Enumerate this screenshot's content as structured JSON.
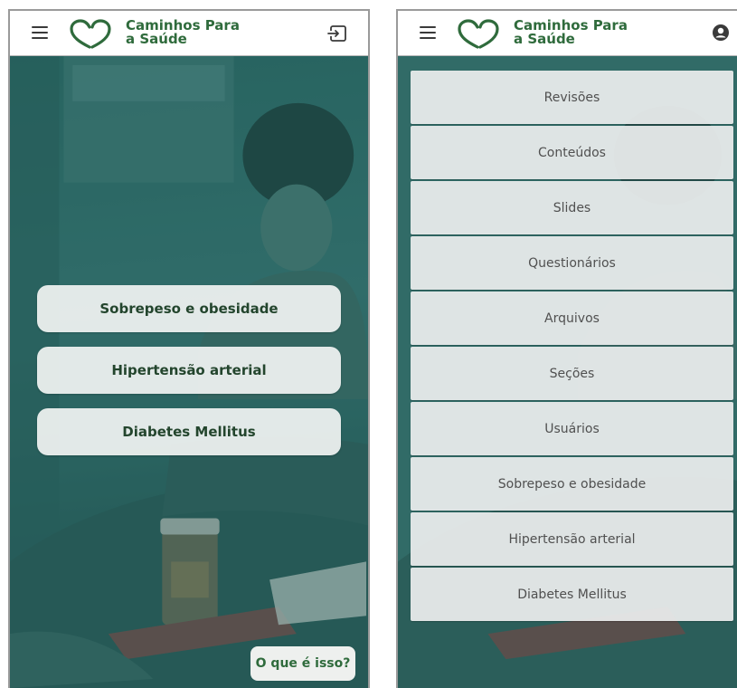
{
  "app": {
    "title_line1": "Caminhos Para",
    "title_line2": "a Saúde"
  },
  "icons": {
    "menu": "menu-icon",
    "logo": "heart-logo-icon",
    "logout": "logout-icon",
    "account": "account-circle-icon"
  },
  "colors": {
    "brand_green": "#2f6b3c",
    "button_bg": "#eef1f0",
    "hero_tint": "#2e6a66"
  },
  "left_screen": {
    "topics": [
      {
        "label": "Sobrepeso e obesidade"
      },
      {
        "label": "Hipertensão arterial"
      },
      {
        "label": "Diabetes Mellitus"
      }
    ],
    "help_label": "O que é isso?"
  },
  "right_screen": {
    "menu_items": [
      {
        "label": "Revisões"
      },
      {
        "label": "Conteúdos"
      },
      {
        "label": "Slides"
      },
      {
        "label": "Questionários"
      },
      {
        "label": "Arquivos"
      },
      {
        "label": "Seções"
      },
      {
        "label": "Usuários"
      },
      {
        "label": "Sobrepeso e obesidade"
      },
      {
        "label": "Hipertensão arterial"
      },
      {
        "label": "Diabetes Mellitus"
      }
    ]
  }
}
